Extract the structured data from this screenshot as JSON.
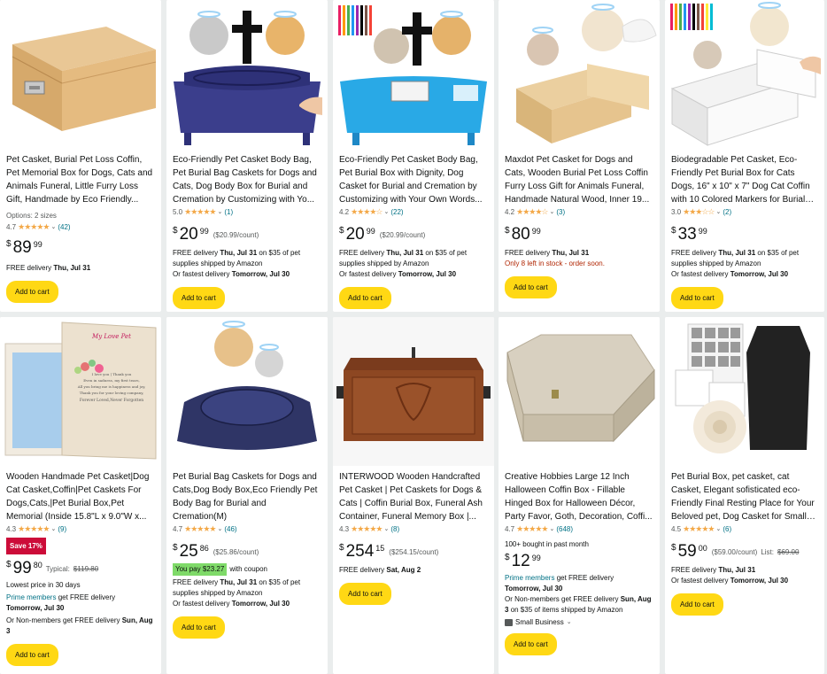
{
  "products": [
    {
      "title": "Pet Casket, Burial Pet Loss Coffin, Pet Memorial Box for Dogs, Cats and Animals Funeral, Little Furry Loss Gift, Handmade by Eco Friendly...",
      "options": "Options: 2 sizes",
      "rating": "4.7",
      "stars": 4.5,
      "reviews": "(42)",
      "price_cur": "$",
      "price_whole": "89",
      "price_frac": "99",
      "delivery": "FREE delivery",
      "delivery_date": "Thu, Jul 31",
      "button": "Add to cart"
    },
    {
      "title": "Eco-Friendly Pet Casket Body Bag, Pet Burial Bag Caskets for Dogs and Cats, Dog Body Box for Burial and Cremation by Customizing with Yo...",
      "rating": "5.0",
      "stars": 5,
      "reviews": "(1)",
      "price_cur": "$",
      "price_whole": "20",
      "price_frac": "99",
      "unit_price": "($20.99/count)",
      "delivery": "FREE delivery",
      "delivery_date": "Thu, Jul 31",
      "delivery_tail": "on $35 of pet supplies shipped by Amazon",
      "fast": "Or fastest delivery",
      "fast_date": "Tomorrow, Jul 30",
      "button": "Add to cart"
    },
    {
      "title": "Eco-Friendly Pet Casket Body Bag, Pet Burial Box with Dignity, Dog Casket for Burial and Cremation by Customizing with Your Own Words...",
      "rating": "4.2",
      "stars": 4,
      "reviews": "(22)",
      "price_cur": "$",
      "price_whole": "20",
      "price_frac": "99",
      "unit_price": "($20.99/count)",
      "delivery": "FREE delivery",
      "delivery_date": "Thu, Jul 31",
      "delivery_tail": "on $35 of pet supplies shipped by Amazon",
      "fast": "Or fastest delivery",
      "fast_date": "Tomorrow, Jul 30",
      "button": "Add to cart"
    },
    {
      "title": "Maxdot Pet Casket for Dogs and Cats, Wooden Burial Pet Loss Coffin Furry Loss Gift for Animals Funeral, Handmade Natural Wood, Inner 19...",
      "rating": "4.2",
      "stars": 4,
      "reviews": "(3)",
      "price_cur": "$",
      "price_whole": "80",
      "price_frac": "99",
      "delivery": "FREE delivery",
      "delivery_date": "Thu, Jul 31",
      "stock": "Only 8 left in stock - order soon.",
      "button": "Add to cart"
    },
    {
      "title": "Biodegradable Pet Casket, Eco-Friendly Pet Burial Box for Cats Dogs, 16\" x 10\" x 7\" Dog Cat Coffin with 10 Colored Markers for Burial or...",
      "rating": "3.0",
      "stars": 3,
      "reviews": "(2)",
      "price_cur": "$",
      "price_whole": "33",
      "price_frac": "99",
      "delivery": "FREE delivery",
      "delivery_date": "Thu, Jul 31",
      "delivery_tail": "on $35 of pet supplies shipped by Amazon",
      "fast": "Or fastest delivery",
      "fast_date": "Tomorrow, Jul 30",
      "button": "Add to cart"
    },
    {
      "title": "Wooden Handmade Pet Casket|Dog Cat Casket,Coffin|Pet Caskets For Dogs,Cats,|Pet Burial Box,Pet Memorial (Inside 15.8\"L x 9.0\"W x...",
      "rating": "4.3",
      "stars": 4.5,
      "reviews": "(9)",
      "badge": "Save 17%",
      "price_cur": "$",
      "price_whole": "99",
      "price_frac": "80",
      "typical_label": "Typical:",
      "typical_price": "$119.80",
      "lowest": "Lowest price in 30 days",
      "prime_label": "Prime members",
      "prime_tail": "get FREE delivery",
      "prime_date": "Tomorrow, Jul 30",
      "nonmember": "Or Non-members get FREE delivery",
      "nonmember_date": "Sun, Aug 3",
      "image_text": [
        "My Love Pet",
        "I love you | Thank you",
        "Even in sadness, my first tears,",
        "All you bring me is happiness and joy,",
        "Thank you for your loving company,",
        "Forever Loved,Never Forgotten"
      ],
      "button": "Add to cart"
    },
    {
      "title": "Pet Burial Bag Caskets for Dogs and Cats,Dog Body Box,Eco Friendly Pet Body Bag for Burial and Cremation(M)",
      "rating": "4.7",
      "stars": 4.5,
      "reviews": "(46)",
      "price_cur": "$",
      "price_whole": "25",
      "price_frac": "86",
      "unit_price": "($25.86/count)",
      "coupon": "You pay $23.27",
      "coupon_tail": "with coupon",
      "delivery": "FREE delivery",
      "delivery_date": "Thu, Jul 31",
      "delivery_tail": "on $35 of pet supplies shipped by Amazon",
      "fast": "Or fastest delivery",
      "fast_date": "Tomorrow, Jul 30",
      "button": "Add to cart"
    },
    {
      "title": "INTERWOOD Wooden Handcrafted Pet Casket | Pet Caskets for Dogs & Cats | Coffin Burial Box, Funeral Ash Container, Funeral Memory Box |...",
      "rating": "4.3",
      "stars": 4.5,
      "reviews": "(8)",
      "price_cur": "$",
      "price_whole": "254",
      "price_frac": "15",
      "unit_price": "($254.15/count)",
      "delivery": "FREE delivery",
      "delivery_date": "Sat, Aug 2",
      "button": "Add to cart"
    },
    {
      "title": "Creative Hobbies Large 12 Inch Halloween Coffin Box - Fillable Hinged Box for Halloween Décor, Party Favor, Goth, Decoration, Coffi...",
      "rating": "4.7",
      "stars": 4.5,
      "reviews": "(648)",
      "bought": "100+ bought in past month",
      "price_cur": "$",
      "price_whole": "12",
      "price_frac": "99",
      "prime_label": "Prime members",
      "prime_tail": "get FREE delivery",
      "prime_date": "Tomorrow, Jul 30",
      "nonmember": "Or Non-members get FREE delivery",
      "nonmember_date": "Sun, Aug 3",
      "nonmember_tail": "on $35 of items shipped by Amazon",
      "small_business": "Small Business",
      "button": "Add to cart"
    },
    {
      "title": "Pet Burial Box, pet casket, cat Casket, Elegant sofisticated eco-Friendly Final Resting Place for Your Beloved pet, Dog Casket for Small Dogs, Do...",
      "rating": "4.5",
      "stars": 4.5,
      "reviews": "(6)",
      "price_cur": "$",
      "price_whole": "59",
      "price_frac": "00",
      "unit_price": "($59.00/count)",
      "list_label": "List:",
      "list_price": "$69.00",
      "delivery": "FREE delivery",
      "delivery_date": "Thu, Jul 31",
      "fast": "Or fastest delivery",
      "fast_date": "Tomorrow, Jul 30",
      "button": "Add to cart"
    }
  ],
  "colors": {
    "button": "#ffd814",
    "star": "#f3a847",
    "link": "#007185",
    "deal_red": "#cc0c39",
    "price_red": "#b12704"
  }
}
